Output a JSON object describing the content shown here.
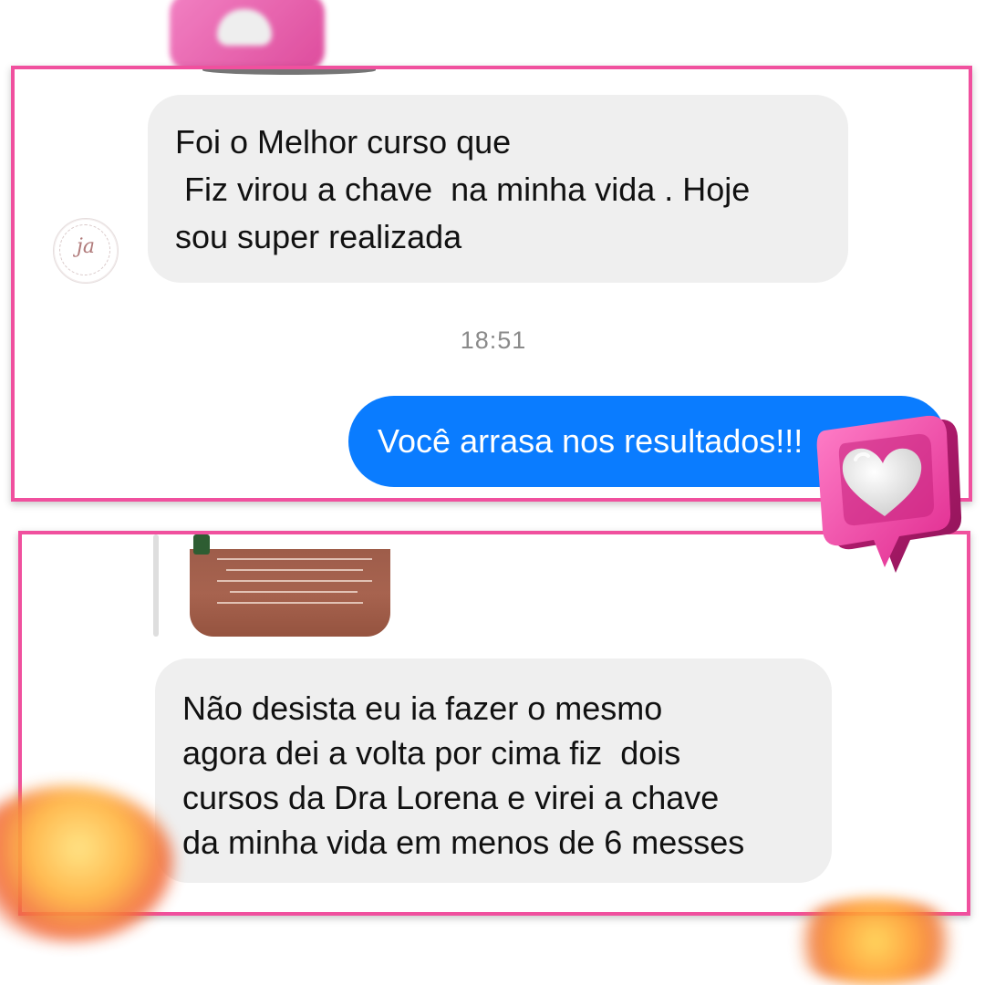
{
  "conversation_1": {
    "incoming_message": {
      "lines": [
        "Foi o Melhor curso que",
        " Fiz virou a chave  na minha vida . Hoje",
        "sou super realizada"
      ]
    },
    "timestamp": "18:51",
    "outgoing_message": "Você arrasa nos resultados!!!",
    "avatar_monogram": "ja"
  },
  "conversation_2": {
    "incoming_message": {
      "lines": [
        "Não desista eu ia fazer o mesmo",
        "agora dei a volta por cima fiz  dois",
        "cursos da Dra Lorena e virei a chave",
        "da minha vida em menos de 6 messes"
      ]
    }
  },
  "colors": {
    "frame_border": "#f0509e",
    "incoming_bubble": "#efefef",
    "outgoing_bubble": "#0a7cff",
    "timestamp_text": "#8a8a8a"
  },
  "icons": {
    "like_badge": "heart-like-badge-icon",
    "top_decoration": "heart-like-badge-icon",
    "emoji_decorations": "blurred-emoji-icon"
  }
}
